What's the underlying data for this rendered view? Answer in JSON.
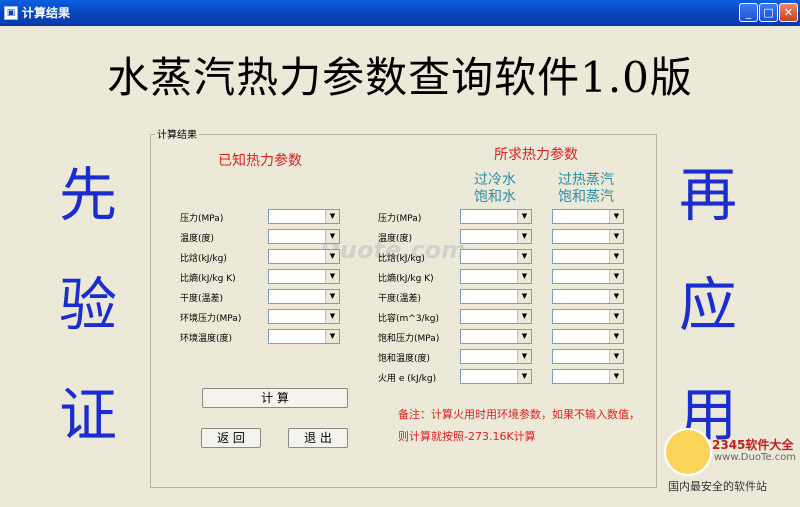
{
  "window": {
    "title": "计算结果",
    "minimize": "_",
    "maximize": "□",
    "close": "✕"
  },
  "app_title": "水蒸汽热力参数查询软件1.0版",
  "left_side": [
    "先",
    "验",
    "证"
  ],
  "right_side": [
    "再",
    "应",
    "用"
  ],
  "group_title": "计算结果",
  "known_header": "已知热力参数",
  "result_header": "所求热力参数",
  "col_subcooled": [
    "过冷水",
    "饱和水"
  ],
  "col_superheated": [
    "过热蒸汽",
    "饱和蒸汽"
  ],
  "known_rows": [
    "压力(MPa)",
    "温度(度)",
    "比焓(kJ/kg)",
    "比熵(kJ/kg K)",
    "干度(温差)",
    "环境压力(MPa)",
    "环境温度(度)"
  ],
  "result_rows": [
    "压力(MPa)",
    "温度(度)",
    "比焓(kJ/kg)",
    "比熵(kJ/kg K)",
    "干度(温差)",
    "比容(m^3/kg)",
    "饱和压力(MPa)",
    "饱和温度(度)",
    "火用 e (kJ/kg)"
  ],
  "buttons": {
    "calc": "计  算",
    "back": "返 回",
    "exit": "退 出"
  },
  "note": "备注：计算火用时用环境参数，如果不输入数值，则计算就按照-273.16K计算",
  "watermark": "Duote.com",
  "logo": {
    "main": "2345软件大全",
    "url": "www.DuoTe.com",
    "bottom": "国内最安全的软件站"
  },
  "icons": {
    "dropdown": "dropdown-arrow-icon"
  }
}
